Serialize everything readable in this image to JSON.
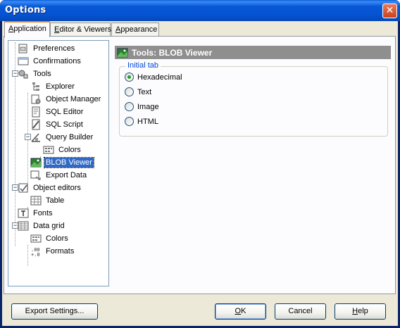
{
  "window": {
    "title": "Options",
    "close_glyph": "✕"
  },
  "tabs": [
    {
      "u": "A",
      "rest": "pplication",
      "active": true
    },
    {
      "u": "E",
      "rest": "ditor & Viewers",
      "active": false
    },
    {
      "u": "A",
      "rest": "ppearance",
      "active": false
    }
  ],
  "tree": {
    "items": [
      {
        "label": "Preferences",
        "icon": "preferences-icon"
      },
      {
        "label": "Confirmations",
        "icon": "confirmations-icon"
      },
      {
        "label": "Tools",
        "icon": "tools-icon",
        "expander": "−"
      },
      {
        "label": "Explorer",
        "icon": "explorer-icon"
      },
      {
        "label": "Object Manager",
        "icon": "object-manager-icon"
      },
      {
        "label": "SQL Editor",
        "icon": "sql-editor-icon"
      },
      {
        "label": "SQL Script",
        "icon": "sql-script-icon"
      },
      {
        "label": "Query Builder",
        "icon": "query-builder-icon",
        "expander": "−"
      },
      {
        "label": "Colors",
        "icon": "colors-icon"
      },
      {
        "label": "BLOB Viewer",
        "icon": "blob-viewer-icon",
        "selected": true
      },
      {
        "label": "Export Data",
        "icon": "export-data-icon"
      },
      {
        "label": "Object editors",
        "icon": "object-editors-icon",
        "expander": "−"
      },
      {
        "label": "Table",
        "icon": "table-icon"
      },
      {
        "label": "Fonts",
        "icon": "fonts-icon"
      },
      {
        "label": "Data grid",
        "icon": "data-grid-icon",
        "expander": "−"
      },
      {
        "label": "Colors",
        "icon": "colors-icon"
      },
      {
        "label": "Formats",
        "icon": "formats-icon"
      }
    ]
  },
  "panel": {
    "header": "Tools: BLOB Viewer",
    "group_title": "Initial tab",
    "options": [
      {
        "label": "Hexadecimal",
        "checked": true
      },
      {
        "label": "Text",
        "checked": false
      },
      {
        "label": "Image",
        "checked": false
      },
      {
        "label": "HTML",
        "checked": false
      }
    ]
  },
  "buttons": {
    "export": "Export Settings...",
    "ok_u": "O",
    "ok_rest": "K",
    "cancel": "Cancel",
    "help_u": "H",
    "help_rest": "elp"
  },
  "colors": {
    "titlebar": "#0553d2",
    "selection": "#316ac5",
    "group_title": "#0046d5",
    "header_bg": "#8f8f8f"
  }
}
